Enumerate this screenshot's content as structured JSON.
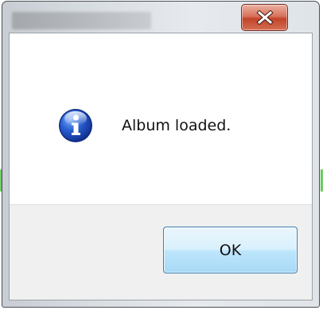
{
  "dialog": {
    "message": "Album loaded.",
    "ok_label": "OK",
    "icon": "information-icon",
    "close_icon": "close-icon"
  },
  "colors": {
    "close_button": "#c7432a",
    "ok_border": "#3c7fb1",
    "info_icon": "#1f4fbf",
    "footer_bg": "#f0f0f0"
  }
}
